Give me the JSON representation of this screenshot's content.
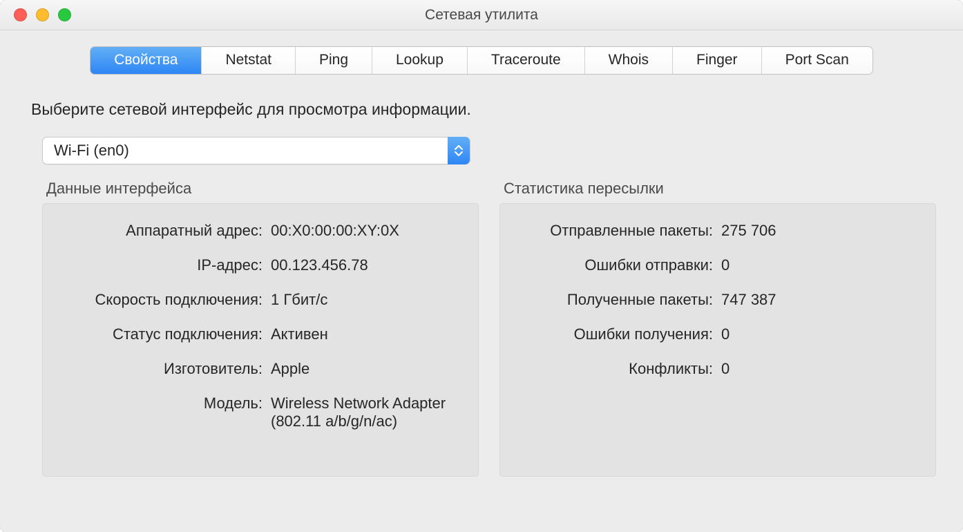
{
  "window": {
    "title": "Сетевая утилита"
  },
  "tabs": [
    "Свойства",
    "Netstat",
    "Ping",
    "Lookup",
    "Traceroute",
    "Whois",
    "Finger",
    "Port Scan"
  ],
  "instruction": "Выберите сетевой интерфейс для просмотра информации.",
  "interfaceSelect": {
    "value": "Wi-Fi (en0)"
  },
  "groups": {
    "interface": {
      "title": "Данные интерфейса",
      "rows": {
        "hwaddr": {
          "label": "Аппаратный адрес:",
          "value": "00:X0:00:00:XY:0X"
        },
        "ipaddr": {
          "label": "IP-адрес:",
          "value": "00.123.456.78"
        },
        "speed": {
          "label": "Скорость подключения:",
          "value": "1 Гбит/с"
        },
        "status": {
          "label": "Статус подключения:",
          "value": "Активен"
        },
        "vendor": {
          "label": "Изготовитель:",
          "value": "Apple"
        },
        "model": {
          "label": "Модель:",
          "value": "Wireless Network Adapter (802.11 a/b/g/n/ac)"
        }
      }
    },
    "stats": {
      "title": "Статистика пересылки",
      "rows": {
        "sent": {
          "label": "Отправленные пакеты:",
          "value": "275 706"
        },
        "sendErr": {
          "label": "Ошибки отправки:",
          "value": "0"
        },
        "recv": {
          "label": "Полученные пакеты:",
          "value": "747 387"
        },
        "recvErr": {
          "label": "Ошибки получения:",
          "value": "0"
        },
        "coll": {
          "label": "Конфликты:",
          "value": "0"
        }
      }
    }
  }
}
